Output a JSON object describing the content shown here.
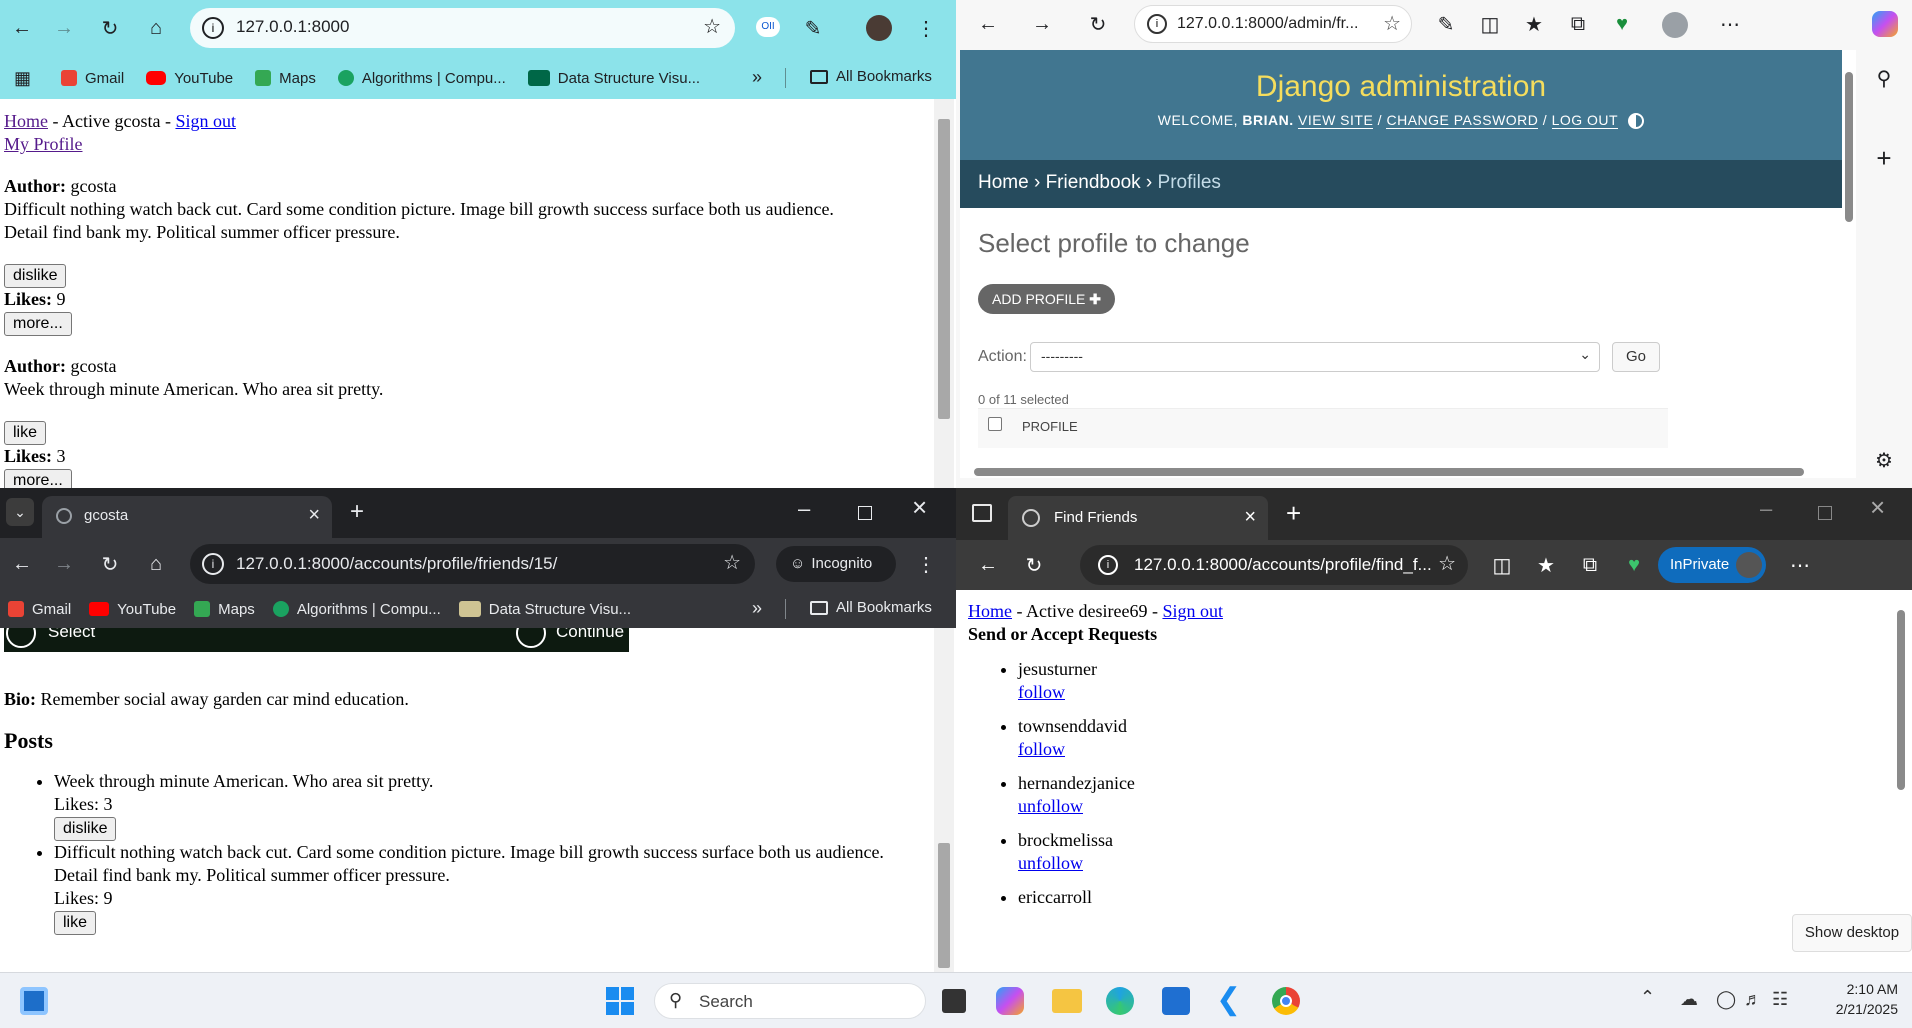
{
  "win1": {
    "url": "127.0.0.1:8000",
    "bookmarks": [
      "Gmail",
      "YouTube",
      "Maps",
      "Algorithms | Compu...",
      "Data Structure Visu..."
    ],
    "all_bookmarks": "All Bookmarks",
    "nav": {
      "home": "Home",
      "active": " - Active gcosta - ",
      "signout": "Sign out",
      "profile": "My Profile"
    },
    "posts": [
      {
        "author_label": "Author:",
        "author": "gcosta",
        "text": "Difficult nothing watch back cut. Card some condition picture. Image bill growth success surface both us audience. Detail find bank my. Political summer officer pressure.",
        "btn": "dislike",
        "likes_label": "Likes:",
        "likes": "9",
        "more": "more..."
      },
      {
        "author_label": "Author:",
        "author": "gcosta",
        "text": "Week through minute American. Who area sit pretty.",
        "btn": "like",
        "likes_label": "Likes:",
        "likes": "3",
        "more": "more..."
      }
    ]
  },
  "win2": {
    "url": "127.0.0.1:8000/admin/fr...",
    "site_title": "Django administration",
    "user_tools": {
      "welcome": "WELCOME, ",
      "user": "BRIAN.",
      "view_site": "VIEW SITE",
      "change_password": "CHANGE PASSWORD",
      "logout": "LOG OUT"
    },
    "breadcrumbs": [
      "Home",
      "Friendbook",
      "Profiles"
    ],
    "heading": "Select profile to change",
    "add_btn": "ADD PROFILE",
    "action_label": "Action:",
    "action_value": "---------",
    "go": "Go",
    "selected": "0 of 11 selected",
    "col_header": "PROFILE"
  },
  "win3": {
    "tab_title": "gcosta",
    "url": "127.0.0.1:8000/accounts/profile/friends/15/",
    "incognito": "Incognito",
    "bookmarks": [
      "Gmail",
      "YouTube",
      "Maps",
      "Algorithms | Compu...",
      "Data Structure Visu..."
    ],
    "all_bookmarks": "All Bookmarks",
    "media": {
      "select": "Select",
      "continue": "Continue"
    },
    "bio_label": "Bio:",
    "bio": "Remember social away garden car mind education.",
    "posts_heading": "Posts",
    "posts": [
      {
        "text": "Week through minute American. Who area sit pretty.",
        "likes": "Likes: 3",
        "btn": "dislike"
      },
      {
        "text": "Difficult nothing watch back cut. Card some condition picture. Image bill growth success surface both us audience. Detail find bank my. Political summer officer pressure.",
        "likes": "Likes: 9",
        "btn": "like"
      }
    ]
  },
  "win4": {
    "tab_title": "Find Friends",
    "url": "127.0.0.1:8000/accounts/profile/find_f...",
    "inprivate": "InPrivate",
    "nav": {
      "home": "Home",
      "active": " - Active desiree69 - ",
      "signout": "Sign out"
    },
    "heading": "Send or Accept Requests",
    "users": [
      {
        "name": "jesusturner",
        "action": "follow"
      },
      {
        "name": "townsenddavid",
        "action": "follow"
      },
      {
        "name": "hernandezjanice",
        "action": "unfollow"
      },
      {
        "name": "brockmelissa",
        "action": "unfollow"
      },
      {
        "name": "ericcarroll",
        "action": ""
      }
    ],
    "tooltip": "Show desktop"
  },
  "taskbar": {
    "search": "Search",
    "time": "2:10 AM",
    "date": "2/21/2025"
  },
  "colors": {
    "chrome_teal": "#8ce3ea",
    "django_header": "#417690",
    "django_crumbs": "#264b5d",
    "django_title": "#f5dd5d",
    "edge_blue": "#0f6cbd"
  }
}
